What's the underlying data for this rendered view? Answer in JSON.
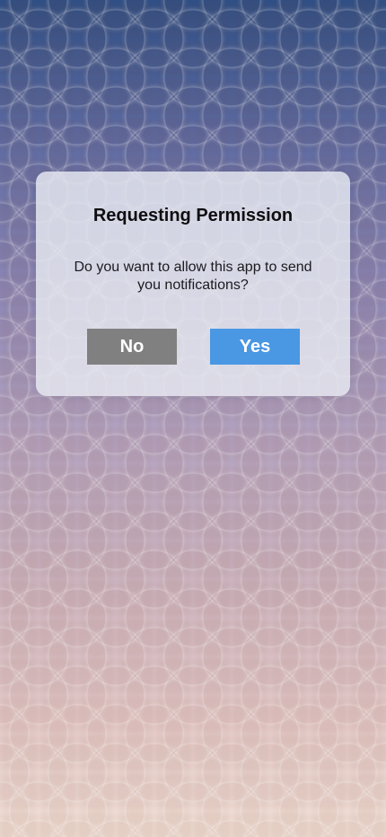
{
  "dialog": {
    "title": "Requesting Permission",
    "message": "Do you want to allow this app to send you notifications?",
    "no_label": "No",
    "yes_label": "Yes"
  },
  "colors": {
    "no_button": "#808080",
    "yes_button": "#4a97e4",
    "dialog_background": "#e8eaf2"
  }
}
